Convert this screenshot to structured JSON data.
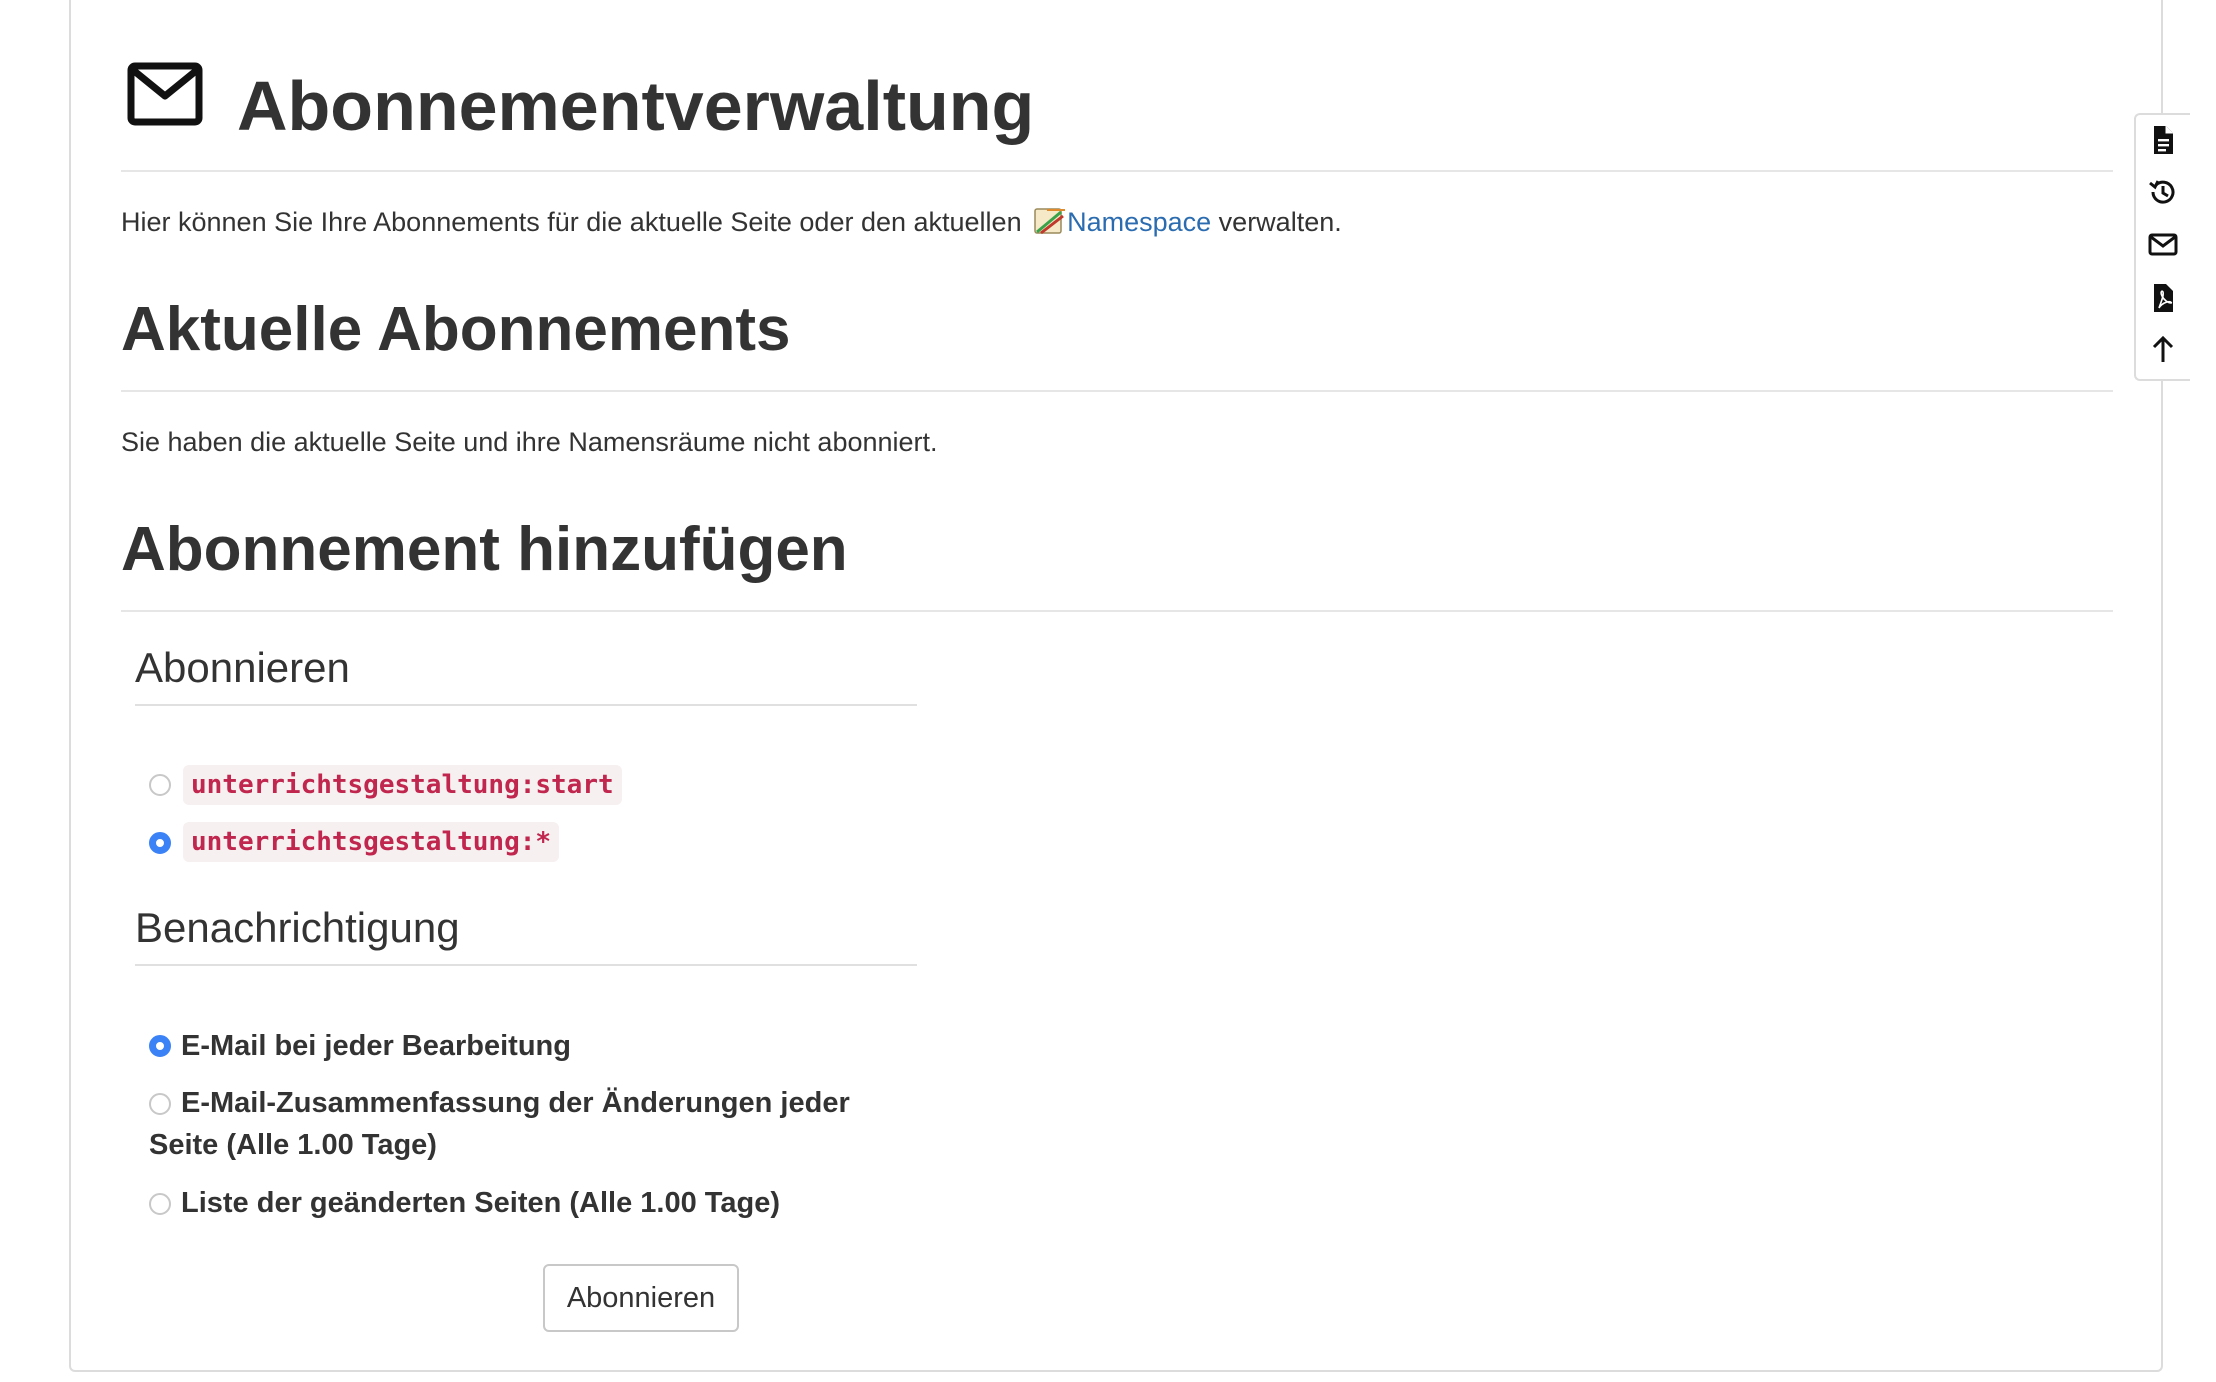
{
  "page": {
    "title": "Abonnementverwaltung",
    "intro_before": "Hier können Sie Ihre Abonnements für die aktuelle Seite oder den aktuellen ",
    "intro_link": "Namespace",
    "intro_after": " verwalten."
  },
  "current": {
    "heading": "Aktuelle Abonnements",
    "status": "Sie haben die aktuelle Seite und ihre Namensräume nicht abonniert."
  },
  "add": {
    "heading": "Abonnement hinzufügen",
    "subscribe_legend": "Abonnieren",
    "targets": [
      {
        "label": "unterrichtsgestaltung:start",
        "checked": false
      },
      {
        "label": "unterrichtsgestaltung:*",
        "checked": true
      }
    ],
    "notify_legend": "Benachrichtigung",
    "styles": [
      {
        "label": "E-Mail bei jeder Bearbeitung",
        "checked": true
      },
      {
        "label_line1": "E-Mail-Zusammenfassung der Änderungen jeder",
        "label_line2": "Seite (Alle 1.00 Tage)",
        "checked": false
      },
      {
        "label": "Liste der geänderten Seiten (Alle 1.00 Tage)",
        "checked": false
      }
    ],
    "submit_label": "Abonnieren"
  },
  "toolbar": {
    "items": [
      "page-icon",
      "history-icon",
      "mail-icon",
      "pdf-icon",
      "arrow-up-icon"
    ]
  },
  "colors": {
    "link": "#2b6cb0",
    "code_text": "#c0264e",
    "radio_checked": "#3b82f6"
  }
}
